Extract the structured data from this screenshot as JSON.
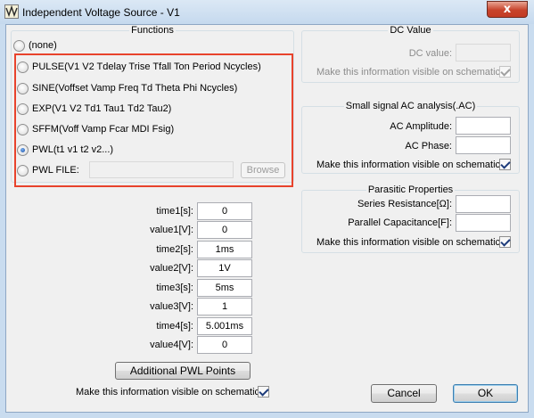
{
  "window": {
    "title": "Independent Voltage Source - V1",
    "close_label": "x"
  },
  "functions": {
    "title": "Functions",
    "options": [
      {
        "label": "(none)",
        "checked": false
      },
      {
        "label": "PULSE(V1 V2 Tdelay Trise Tfall Ton Period Ncycles)",
        "checked": false
      },
      {
        "label": "SINE(Voffset Vamp Freq Td Theta Phi Ncycles)",
        "checked": false
      },
      {
        "label": "EXP(V1 V2 Td1 Tau1 Td2 Tau2)",
        "checked": false
      },
      {
        "label": "SFFM(Voff Vamp Fcar MDI Fsig)",
        "checked": false
      },
      {
        "label": "PWL(t1 v1 t2 v2...)",
        "checked": true
      },
      {
        "label": "PWL FILE:",
        "checked": false
      }
    ],
    "pwl_file_value": "",
    "browse_label": "Browse"
  },
  "pwl_points": [
    {
      "label": "time1[s]:",
      "value": "0"
    },
    {
      "label": "value1[V]:",
      "value": "0"
    },
    {
      "label": "time2[s]:",
      "value": "1ms"
    },
    {
      "label": "value2[V]:",
      "value": "1V"
    },
    {
      "label": "time3[s]:",
      "value": "5ms"
    },
    {
      "label": "value3[V]:",
      "value": "1"
    },
    {
      "label": "time4[s]:",
      "value": "5.001ms"
    },
    {
      "label": "value4[V]:",
      "value": "0"
    }
  ],
  "additional_pwl_label": "Additional PWL Points",
  "visible_label": "Make this information visible on schematic:",
  "dc": {
    "title": "DC Value",
    "dc_value_label": "DC value:",
    "dc_value": "",
    "visible_checked": true
  },
  "ac": {
    "title": "Small signal AC analysis(.AC)",
    "amplitude_label": "AC Amplitude:",
    "amplitude_value": "",
    "phase_label": "AC Phase:",
    "phase_value": "",
    "visible_checked": true
  },
  "parasitic": {
    "title": "Parasitic Properties",
    "series_label": "Series Resistance[Ω]:",
    "series_value": "",
    "parallel_label": "Parallel Capacitance[F]:",
    "parallel_value": "",
    "visible_checked": true
  },
  "bottom_visible_checked": true,
  "buttons": {
    "cancel": "Cancel",
    "ok": "OK"
  },
  "colors": {
    "highlight": "#e8432c",
    "titlebar": "#c9dcef",
    "close": "#c7432b"
  }
}
